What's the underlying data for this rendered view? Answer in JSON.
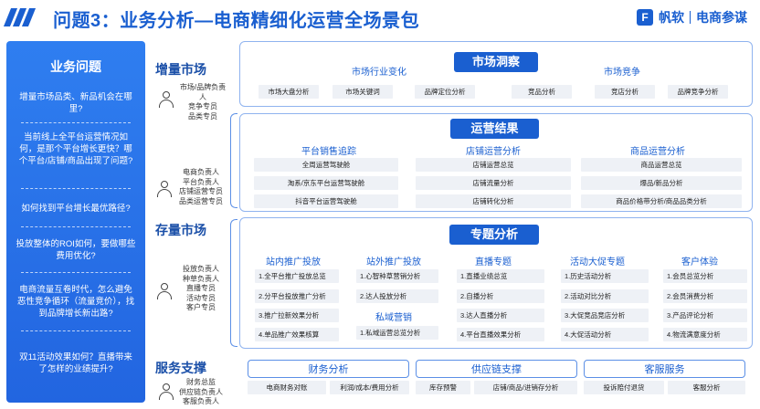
{
  "header": {
    "title": "问题3：业务分析—电商精细化运营全场景包",
    "brand_name": "帆软",
    "brand_sub": "电商参谋",
    "brand_logo_char": "F"
  },
  "left_panel": {
    "title": "业务问题",
    "questions": [
      "增量市场品类、新品机会在哪里?",
      "当前线上全平台运营情况如何，是那个平台增长更快？哪个平台/店铺/商品出现了问题?",
      "如何找到平台增长最优路径?",
      "投放整体的ROI如何，要做哪些费用优化?",
      "电商流量互卷时代，怎么避免恶性竞争循环（流量竞价），找到品牌增长新出路?",
      "双11活动效果如何？直播带来了怎样的业绩提升?"
    ]
  },
  "labels": {
    "incremental": "增量市场",
    "stock": "存量市场",
    "support": "服务支撑",
    "roles_incremental": "市场/品牌负责人\n竞争专员\n品类专员",
    "roles_stock_1": "电商负责人\n平台负责人\n店铺运营专员\n品类运营专员",
    "roles_stock_2": "投放负责人\n种草负责人\n直播专员\n活动专员\n客户专员",
    "roles_support": "财务总监\n供应链负责人\n客服负责人"
  },
  "market": {
    "head": "市场洞察",
    "groups": [
      "市场行业变化",
      "市场竞争"
    ],
    "chips": [
      "市场大盘分析",
      "市场关键词",
      "品牌定位分析",
      "竞品分析",
      "竞店分析",
      "品牌竞争分析"
    ]
  },
  "ops": {
    "head": "运营结果",
    "groups": [
      "平台销售追踪",
      "店铺运营分析",
      "商品运营分析"
    ],
    "col1": [
      "全周运营驾驶舱",
      "淘系/京东平台运营驾驶舱",
      "抖音平台运营驾驶舱"
    ],
    "col2": [
      "店铺运营总览",
      "店铺流量分析",
      "店铺转化分析"
    ],
    "col3": [
      "商品运营总览",
      "爆品/新品分析",
      "商品价格带分析/商品品类分析"
    ]
  },
  "topic": {
    "head": "专题分析",
    "groups": [
      "站内推广投放",
      "站外推广投放",
      "直播专题",
      "活动大促专题",
      "客户体验",
      "私域营销"
    ],
    "col1": [
      "1.全平台推广投放总览",
      "2.分平台投放推广分析",
      "3.推广拉新效果分析",
      "4.单品推广效果核算"
    ],
    "col2": [
      "1.心智种草营销分析",
      "2.达人投放分析"
    ],
    "col2b": [
      "1.私域运营总览分析"
    ],
    "col3": [
      "1.直播业绩总览",
      "2.自播分析",
      "3.达人直播分析",
      "4.平台直播效果分析"
    ],
    "col4": [
      "1.历史活动分析",
      "2.活动对比分析",
      "3.大促竞品竞店分析",
      "4.大促活动分析"
    ],
    "col5": [
      "1.会员总览分析",
      "2.会员消费分析",
      "3.产品评论分析",
      "4.物流满意度分析"
    ]
  },
  "support": {
    "heads": [
      "财务分析",
      "供应链支撑",
      "客服服务"
    ],
    "chips": [
      "电商财务对账",
      "利润/成本/费用分析",
      "库存预警",
      "店铺/商品/进销存分析",
      "投诉赔付退货",
      "客服分析"
    ]
  }
}
